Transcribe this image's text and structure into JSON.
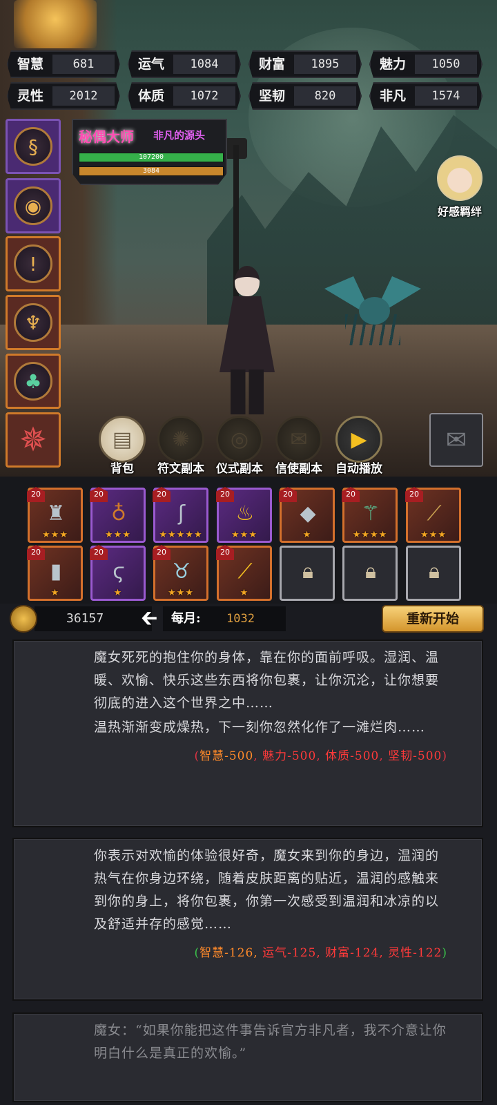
{
  "stats": [
    {
      "label": "智慧",
      "value": "681"
    },
    {
      "label": "运气",
      "value": "1084"
    },
    {
      "label": "财富",
      "value": "1895"
    },
    {
      "label": "魅力",
      "value": "1050"
    },
    {
      "label": "灵性",
      "value": "2012"
    },
    {
      "label": "体质",
      "value": "1072"
    },
    {
      "label": "坚韧",
      "value": "820"
    },
    {
      "label": "非凡",
      "value": "1574"
    }
  ],
  "title_plate": {
    "rank": "秘偶大师",
    "subtitle": "非凡的源头",
    "hp": "107200",
    "mp": "3084",
    "hp_fraction": 1.0,
    "mp_fraction": 1.0
  },
  "affinity": {
    "label": "好感羁绊"
  },
  "actions": [
    {
      "label": "背包",
      "icon": "scroll-icon",
      "state": "on"
    },
    {
      "label": "符文副本",
      "icon": "rune-icon",
      "state": "off"
    },
    {
      "label": "仪式副本",
      "icon": "eye-icon",
      "state": "off"
    },
    {
      "label": "信使副本",
      "icon": "envelope-icon",
      "state": "off"
    },
    {
      "label": "自动播放",
      "icon": "play-icon",
      "state": "play"
    }
  ],
  "inventory": [
    {
      "level": "20",
      "icon": "armor-icon",
      "stars": "★★★",
      "rarity": "orange"
    },
    {
      "level": "20",
      "icon": "necklace-icon",
      "stars": "★★★",
      "rarity": "purple"
    },
    {
      "level": "20",
      "icon": "hook-icon",
      "stars": "★★★★★",
      "rarity": "purple"
    },
    {
      "level": "20",
      "icon": "candle-icon",
      "stars": "★★★",
      "rarity": "purple"
    },
    {
      "level": "20",
      "icon": "tablet-icon",
      "stars": "★",
      "rarity": "orange"
    },
    {
      "level": "20",
      "icon": "scepter-icon",
      "stars": "★★★★",
      "rarity": "orange"
    },
    {
      "level": "20",
      "icon": "staff-icon",
      "stars": "★★★",
      "rarity": "orange"
    },
    {
      "level": "20",
      "icon": "pipe-icon",
      "stars": "★",
      "rarity": "orange"
    },
    {
      "level": "20",
      "icon": "serpent-icon",
      "stars": "★",
      "rarity": "purple"
    },
    {
      "level": "20",
      "icon": "goblet-icon",
      "stars": "★★★",
      "rarity": "orange"
    },
    {
      "level": "20",
      "icon": "wand-icon",
      "stars": "★",
      "rarity": "orange"
    },
    {
      "level": "",
      "icon": "lock-icon",
      "stars": "",
      "rarity": "locked"
    },
    {
      "level": "",
      "icon": "lock-icon",
      "stars": "",
      "rarity": "locked"
    },
    {
      "level": "",
      "icon": "lock-icon",
      "stars": "",
      "rarity": "locked"
    }
  ],
  "currency": {
    "gold": "36157",
    "monthly_label": "每月:",
    "monthly_value": "1032"
  },
  "restart_label": "重新开始",
  "log": [
    {
      "text1": "魔女死死的抱住你的身体，靠在你的面前呼吸。湿润、温暖、欢愉、快乐这些东西将你包裹，让你沉沦，让你想要彻底的进入这个世界之中……",
      "text2": "温热渐渐变成燥热，下一刻你忽然化作了一滩烂肉……",
      "effects": [
        {
          "text": "智慧-500",
          "color": "orange"
        },
        {
          "text": "魅力-500",
          "color": "red"
        },
        {
          "text": "体质-500",
          "color": "red"
        },
        {
          "text": "坚韧-500",
          "color": "red"
        }
      ]
    },
    {
      "text1": "你表示对欢愉的体验很好奇，魔女来到你的身边，温润的热气在你身边环绕，随着皮肤距离的贴近，温润的感触来到你的身上，将你包裹，你第一次感受到温润和冰凉的以及舒适并存的感觉……",
      "effects": [
        {
          "text": "智慧-126",
          "color": "orange"
        },
        {
          "text": "运气-125",
          "color": "red"
        },
        {
          "text": "财富-124",
          "color": "red"
        },
        {
          "text": "灵性-122",
          "color": "red"
        }
      ]
    },
    {
      "text1": "魔女：“如果你能把这件事告诉官方非凡者，我不介意让你明白什么是真正的欢愉。”"
    }
  ],
  "colors": {
    "accent_gold": "#d4952c",
    "hp_green": "#35b04a",
    "mp_orange": "#c8872c"
  }
}
